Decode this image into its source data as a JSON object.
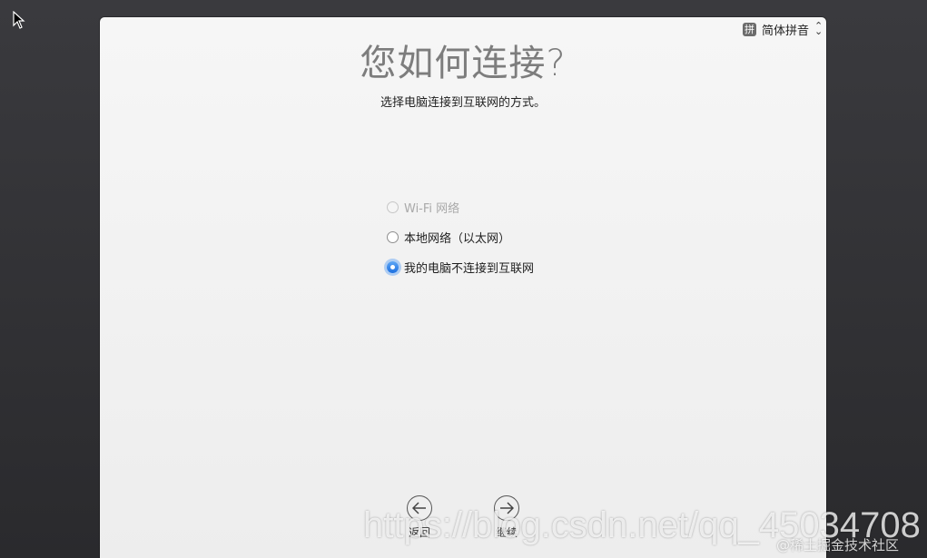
{
  "input_source": {
    "badge": "拼",
    "label": "简体拼音"
  },
  "title": "您如何连接?",
  "subtitle": "选择电脑连接到互联网的方式。",
  "options": [
    {
      "label": "Wi-Fi 网络",
      "state": "disabled"
    },
    {
      "label": "本地网络（以太网）",
      "state": "enabled"
    },
    {
      "label": "我的电脑不连接到互联网",
      "state": "selected"
    }
  ],
  "nav": {
    "back_label": "返回",
    "continue_label": "继续"
  },
  "watermark": {
    "url": "https://blog.csdn.net/qq_45034708",
    "credit": "@稀土掘金技术社区"
  },
  "colors": {
    "accent": "#1c6fe0",
    "title": "#7d7d7d"
  }
}
